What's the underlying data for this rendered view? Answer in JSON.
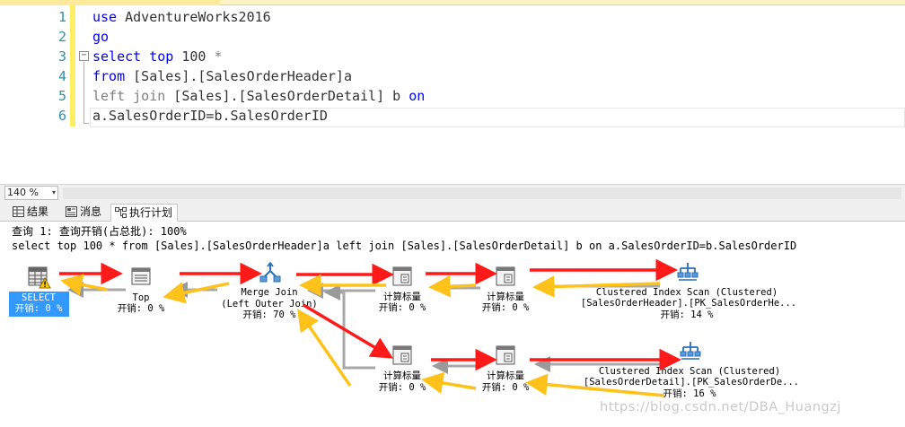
{
  "editor": {
    "line_numbers": [
      "1",
      "2",
      "3",
      "4",
      "5",
      "6"
    ],
    "line1": {
      "kw": "use",
      "rest": " AdventureWorks2016"
    },
    "line2": {
      "kw": "go"
    },
    "line3": {
      "kw": "select top",
      "num": " 100 ",
      "star": "*"
    },
    "line4": {
      "kw": "from",
      "rest": " [Sales].[SalesOrderHeader]a"
    },
    "line5": {
      "kw": "left join",
      "rest": " [Sales].[SalesOrderDetail] b ",
      "kw2": "on"
    },
    "line6": {
      "rest": "a.SalesOrderID=b.SalesOrderID"
    },
    "fold_symbol": "−"
  },
  "zoom": {
    "value": "140 %",
    "arrow": "▾"
  },
  "tabs": [
    {
      "label": "结果",
      "icon": "grid-icon"
    },
    {
      "label": "消息",
      "icon": "messages-icon"
    },
    {
      "label": "执行计划",
      "icon": "plan-icon"
    }
  ],
  "plan": {
    "query_cost_line": "查询 1: 查询开销(占总批): 100%",
    "query_text": "select top 100 * from [Sales].[SalesOrderHeader]a left join [Sales].[SalesOrderDetail] b on a.SalesOrderID=b.SalesOrderID",
    "nodes": {
      "select": {
        "name": "SELECT",
        "cost": "开销: 0 %"
      },
      "top": {
        "name": "Top",
        "cost": "开销: 0 %"
      },
      "merge": {
        "name": "Merge Join",
        "sub": "(Left Outer Join)",
        "cost": "开销: 70 %"
      },
      "compute1": {
        "name": "计算标量",
        "cost": "开销: 0 %"
      },
      "compute2": {
        "name": "计算标量",
        "cost": "开销: 0 %"
      },
      "scan1": {
        "name": "Clustered Index Scan (Clustered)",
        "sub": "[SalesOrderHeader].[PK_SalesOrderHe...",
        "cost": "开销: 14 %"
      },
      "compute3": {
        "name": "计算标量",
        "cost": "开销: 0 %"
      },
      "compute4": {
        "name": "计算标量",
        "cost": "开销: 0 %"
      },
      "scan2": {
        "name": "Clustered Index Scan (Clustered)",
        "sub": "[SalesOrderDetail].[PK_SalesOrderDe...",
        "cost": "开销: 16 %"
      }
    },
    "annotation_colors": {
      "red": "#ff1a1a",
      "yellow": "#ffc21a"
    }
  },
  "watermark": "https://blog.csdn.net/DBA_Huangzj"
}
